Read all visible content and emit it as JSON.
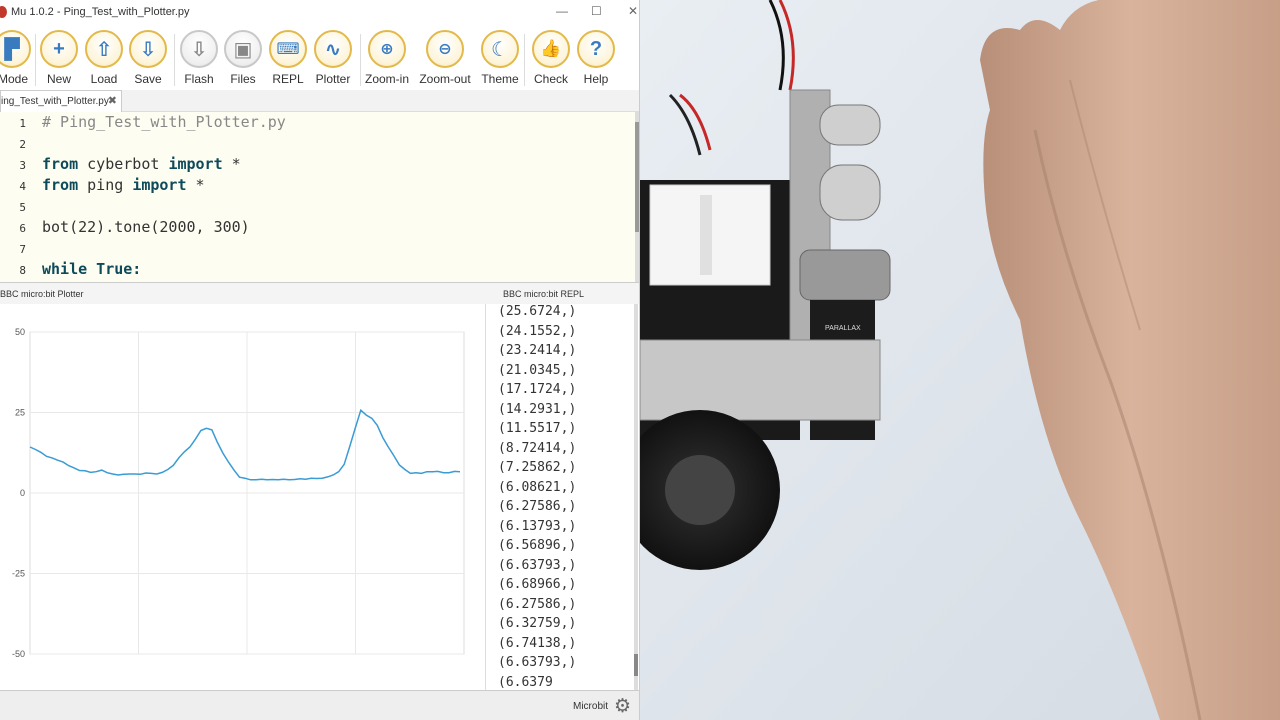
{
  "window": {
    "title": "Mu 1.0.2 - Ping_Test_with_Plotter.py",
    "minimize": "—",
    "maximize": "☐",
    "close": "✕"
  },
  "toolbar": {
    "mode": "Mode",
    "new": "New",
    "load": "Load",
    "save": "Save",
    "flash": "Flash",
    "files": "Files",
    "repl": "REPL",
    "plotter": "Plotter",
    "zoom_in": "Zoom-in",
    "zoom_out": "Zoom-out",
    "theme": "Theme",
    "check": "Check",
    "help": "Help"
  },
  "tab": {
    "label": "ing_Test_with_Plotter.py",
    "close": "✖"
  },
  "editor": {
    "line_numbers": [
      "1",
      "2",
      "3",
      "4",
      "5",
      "6",
      "7",
      "8"
    ],
    "line1": "# Ping_Test_with_Plotter.py",
    "line3_kw1": "from",
    "line3_mod": " cyberbot ",
    "line3_kw2": "import",
    "line3_rest": " *",
    "line4_kw1": "from",
    "line4_mod": " ping ",
    "line4_kw2": "import",
    "line4_rest": " *",
    "line6": "bot(22).tone(2000, 300)",
    "line8": "while True:"
  },
  "panes": {
    "plotter_title": "BBC micro:bit Plotter",
    "repl_title": "BBC micro:bit REPL"
  },
  "chart_data": {
    "type": "line",
    "yticks": [
      "50",
      "25",
      "0",
      "-25",
      "-50"
    ],
    "ylim": [
      -50,
      50
    ],
    "grid": true,
    "series": [
      {
        "color": "#3a9bd5",
        "values": [
          14.3,
          13.5,
          12.6,
          11.4,
          10.9,
          10.2,
          9.6,
          8.5,
          7.8,
          7.0,
          6.9,
          6.4,
          6.6,
          7.1,
          6.3,
          5.9,
          5.6,
          5.8,
          5.9,
          5.9,
          5.8,
          6.2,
          6.1,
          5.9,
          6.4,
          7.3,
          8.6,
          10.9,
          12.8,
          14.3,
          16.7,
          19.4,
          20.1,
          19.6,
          15.7,
          12.4,
          9.6,
          7.1,
          4.9,
          4.6,
          4.1,
          4.1,
          4.3,
          4.1,
          4.2,
          4.1,
          4.3,
          4.1,
          4.2,
          4.4,
          4.3,
          4.6,
          4.5,
          4.6,
          5.0,
          5.6,
          6.6,
          8.9,
          14.4,
          20.2,
          25.7,
          24.2,
          23.2,
          21.0,
          17.2,
          14.3,
          11.6,
          8.7,
          7.3,
          6.1,
          6.3,
          6.1,
          6.6,
          6.6,
          6.7,
          6.3,
          6.3,
          6.7,
          6.6
        ]
      }
    ]
  },
  "repl": {
    "lines": [
      "(25.6724,)",
      "(24.1552,)",
      "(23.2414,)",
      "(21.0345,)",
      "(17.1724,)",
      "(14.2931,)",
      "(11.5517,)",
      "(8.72414,)",
      "(7.25862,)",
      "(6.08621,)",
      "(6.27586,)",
      "(6.13793,)",
      "(6.56896,)",
      "(6.63793,)",
      "(6.68966,)",
      "(6.27586,)",
      "(6.32759,)",
      "(6.74138,)",
      "(6.63793,)",
      "(6.6379"
    ]
  },
  "status": {
    "mode": "Microbit",
    "settings_icon": "gear-icon"
  }
}
